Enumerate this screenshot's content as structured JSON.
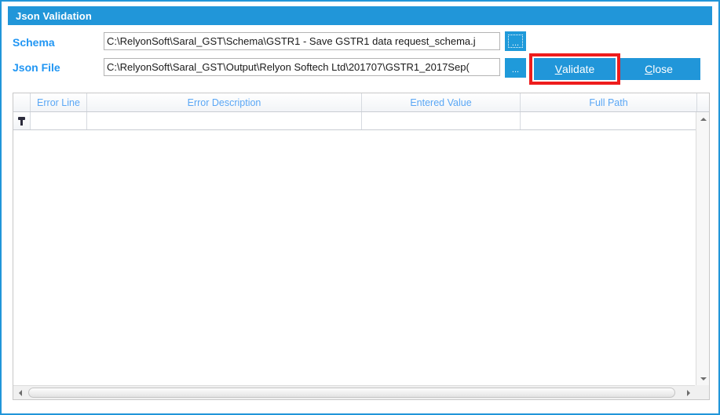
{
  "window": {
    "title": "Json Validation",
    "accent_color": "#2196d9",
    "label_color": "#2196f3",
    "highlight_color": "#ee1c1c"
  },
  "form": {
    "schema": {
      "label": "Schema",
      "value": "C:\\RelyonSoft\\Saral_GST\\Schema\\GSTR1 - Save GSTR1 data request_schema.j",
      "placeholder": "",
      "browse_label": "..."
    },
    "json_file": {
      "label": "Json File",
      "value": "C:\\RelyonSoft\\Saral_GST\\Output\\Relyon Softech Ltd\\201707\\GSTR1_2017Sep(",
      "placeholder": "",
      "browse_label": "..."
    }
  },
  "buttons": {
    "validate": {
      "accel": "V",
      "rest": "alidate"
    },
    "close": {
      "accel": "C",
      "rest": "lose"
    }
  },
  "grid": {
    "columns": [
      {
        "key": "rowheader",
        "label": ""
      },
      {
        "key": "error_line",
        "label": "Error Line"
      },
      {
        "key": "error_description",
        "label": "Error Description"
      },
      {
        "key": "entered_value",
        "label": "Entered Value"
      },
      {
        "key": "full_path",
        "label": "Full Path"
      }
    ],
    "rows": [],
    "new_row_indicator": "new-row-pin",
    "scrollbars": {
      "vertical": {
        "up_arrow": "triangle-up-icon",
        "down_arrow": "triangle-down-icon"
      },
      "horizontal": {
        "left_arrow": "triangle-left-icon",
        "right_arrow": "triangle-right-icon"
      }
    }
  }
}
